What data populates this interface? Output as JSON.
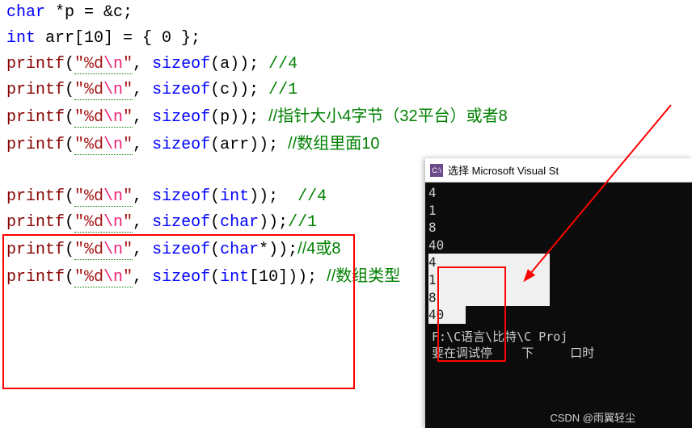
{
  "code": {
    "line0_partial": "char *p = &c;",
    "line1": {
      "type": "int",
      "decl": "arr[10] = { 0 };"
    },
    "printf_lines": [
      {
        "fmt": "\"%d\\n\"",
        "arg": "sizeof(a)",
        "comment": "//4"
      },
      {
        "fmt": "\"%d\\n\"",
        "arg": "sizeof(c)",
        "comment": "//1"
      },
      {
        "fmt": "\"%d\\n\"",
        "arg": "sizeof(p)",
        "comment": "//指针大小4字节（32平台）或者8"
      },
      {
        "fmt": "\"%d\\n\"",
        "arg": "sizeof(arr)",
        "comment": "//数组里面10"
      }
    ],
    "printf_lines2": [
      {
        "fmt": "\"%d\\n\"",
        "arg": "sizeof(int)",
        "space": "  ",
        "comment": "//4"
      },
      {
        "fmt": "\"%d\\n\"",
        "arg": "sizeof(char)",
        "space": "",
        "comment": "//1"
      },
      {
        "fmt": "\"%d\\n\"",
        "arg": "sizeof(char*)",
        "space": "",
        "comment": "//4或8"
      },
      {
        "fmt": "\"%d\\n\"",
        "arg": "sizeof(int[10])",
        "space": " ",
        "comment": "//数组类型"
      }
    ],
    "fn_name": "printf",
    "sizeof_kw": "sizeof"
  },
  "console": {
    "title_prefix": "选择",
    "title_app": "Microsoft Visual St",
    "icon_text": "C:\\",
    "output": [
      "4",
      "1",
      "8",
      "40",
      "4",
      "1",
      "8",
      "40"
    ],
    "path_line1": "F:\\C语言\\比特\\C Proj",
    "path_line2": "要在调试停    下     口时"
  },
  "watermark": "CSDN @雨翼轻尘"
}
